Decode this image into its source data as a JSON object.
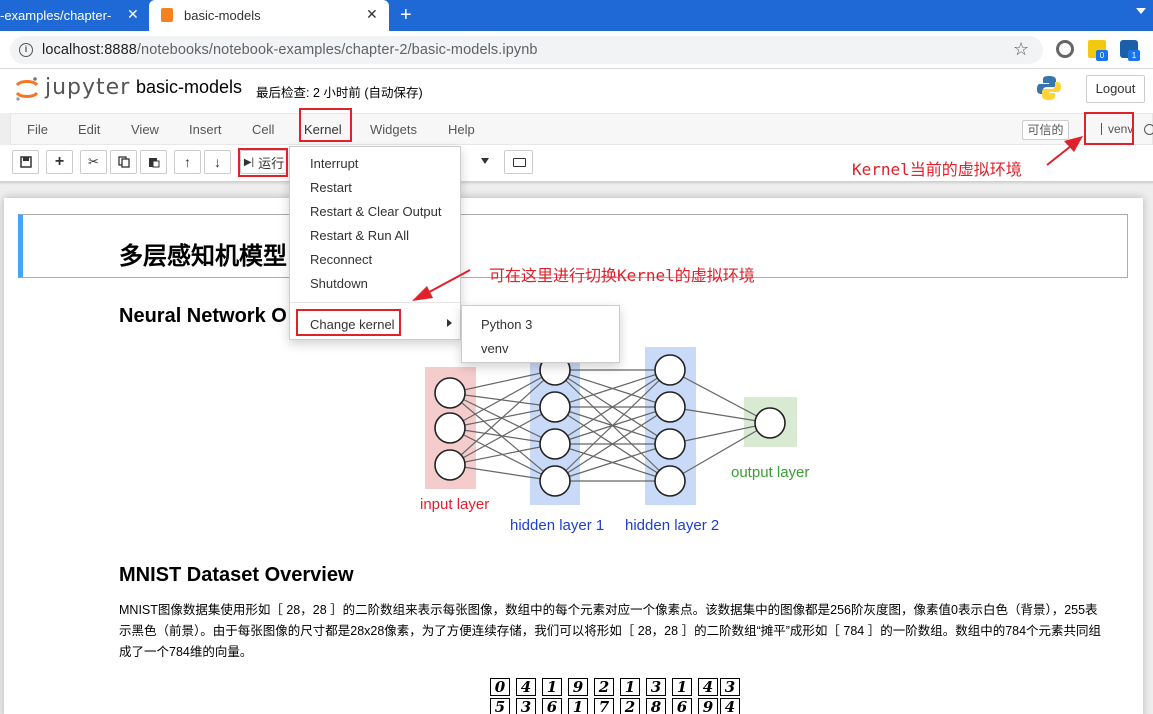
{
  "browser": {
    "tabs": [
      {
        "title": "-examples/chapter-",
        "active": false
      },
      {
        "title": "basic-models",
        "active": true
      }
    ],
    "close_glyph": "✕",
    "new_tab_glyph": "+",
    "url_host": "localhost:8888",
    "url_path": "/notebooks/notebook-examples/chapter-2/basic-models.ipynb",
    "ext_badges": [
      "0",
      "1"
    ]
  },
  "jupyter": {
    "logo_text": "jupyter",
    "notebook_name": "basic-models",
    "checkpoint": "最后检查: 2 小时前   (自动保存)",
    "logout_label": "Logout",
    "menu": [
      "File",
      "Edit",
      "View",
      "Insert",
      "Cell",
      "Kernel",
      "Widgets",
      "Help"
    ],
    "trusted_label": "可信的",
    "kernel_name": "venv",
    "run_label": "运行"
  },
  "kernel_menu": {
    "items": [
      "Interrupt",
      "Restart",
      "Restart & Clear Output",
      "Restart & Run All",
      "Reconnect",
      "Shutdown"
    ],
    "change_kernel": "Change kernel",
    "submenu": [
      "Python 3",
      "venv"
    ]
  },
  "notebook": {
    "h1": "多层感知机模型",
    "h2_nn": "Neural Network O",
    "h2_mnist": "MNIST Dataset Overview",
    "paragraph": "MNIST图像数据集使用形如［ 28，28 ］的二阶数组来表示每张图像，数组中的每个元素对应一个像素点。该数据集中的图像都是256阶灰度图，像素值0表示白色（背景），255表示黑色（前景）。由于每张图像的尺寸都是28x28像素，为了方便连续存储，我们可以将形如［ 28，28 ］的二阶数组“摊平”成形如［ 784 ］的一阶数组。数组中的784个元素共同组成了一个784维的向量。",
    "figure_labels": {
      "input": "input layer",
      "hidden1": "hidden layer 1",
      "hidden2": "hidden layer 2",
      "output": "output layer"
    },
    "mnist_row1": [
      "0",
      "4",
      "1",
      "9",
      "2",
      "1",
      "3",
      "1",
      "4",
      "3"
    ],
    "mnist_row2": [
      "5",
      "3",
      "6",
      "1",
      "7",
      "2",
      "8",
      "6",
      "9",
      "4"
    ]
  },
  "annotations": {
    "kernel_env": "Kernel当前的虚拟环境",
    "switch_kernel": "可在这里进行切换Kernel的虚拟环境"
  },
  "colors": {
    "annotation_red": "#e0202a",
    "tab_strip": "#1e69d6",
    "input_layer": "#f4cccc",
    "hidden_layer": "#c9daf8",
    "output_layer": "#d9ead3",
    "selected_cell_bar": "#42a5f5"
  }
}
